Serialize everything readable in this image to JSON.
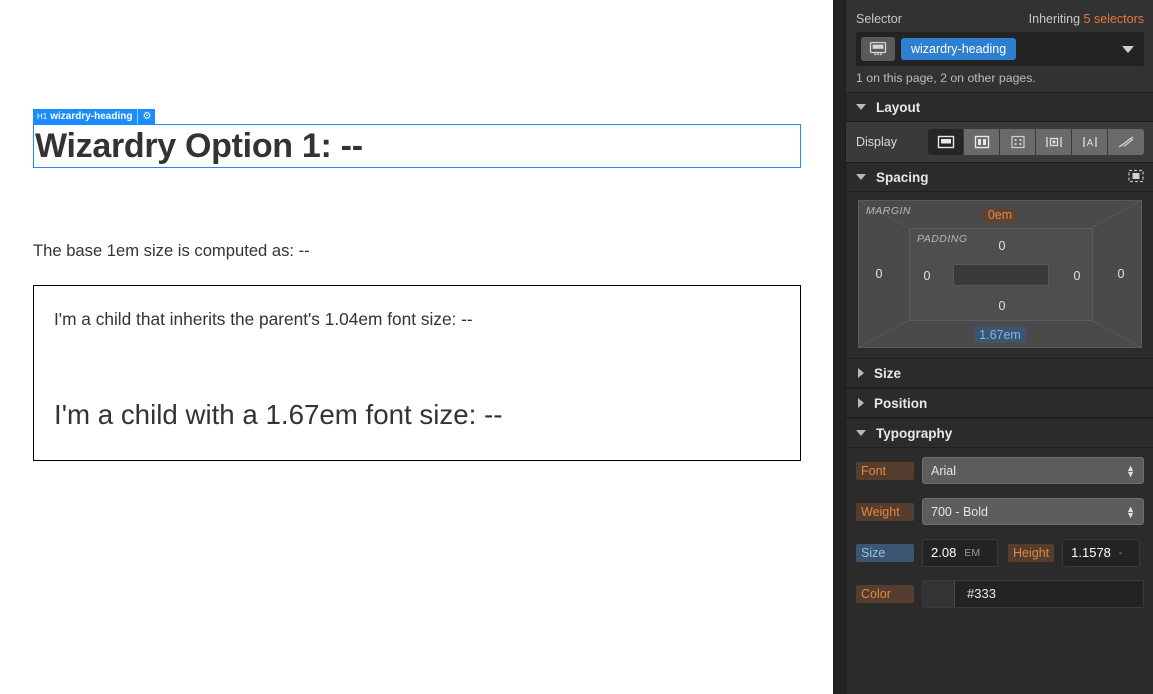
{
  "canvas": {
    "badge": {
      "tag": "H1",
      "name": "wizardry-heading",
      "gear_icon": "gear-icon"
    },
    "heading": "Wizardry Option 1: --",
    "paragraph": "The base 1em size is computed as: --",
    "child_inherit": "I'm a child that inherits the parent's 1.04em font size: --",
    "child_sized": "I'm a child with a 1.67em font size: --"
  },
  "panel": {
    "selector": {
      "label": "Selector",
      "inheriting_prefix": "Inheriting ",
      "inheriting_count": "5 selectors",
      "device_icon": "desktop-icon",
      "chip": "wizardry-heading",
      "dropdown_icon": "chevron-down-icon",
      "usage": "1 on this page, 2 on other pages."
    },
    "sections": {
      "layout": {
        "title": "Layout",
        "expanded": true
      },
      "spacing": {
        "title": "Spacing",
        "expanded": true,
        "icon": "box-model-icon"
      },
      "size": {
        "title": "Size",
        "expanded": false
      },
      "position": {
        "title": "Position",
        "expanded": false
      },
      "typography": {
        "title": "Typography",
        "expanded": true
      }
    },
    "display": {
      "label": "Display",
      "options": [
        {
          "icon": "display-block-icon",
          "active": true
        },
        {
          "icon": "display-flex-icon",
          "active": false
        },
        {
          "icon": "display-grid-icon",
          "active": false
        },
        {
          "icon": "display-inline-block-icon",
          "active": false
        },
        {
          "icon": "display-inline-icon",
          "active": false
        },
        {
          "icon": "display-none-icon",
          "active": false
        }
      ]
    },
    "box_model": {
      "margin_label": "MARGIN",
      "padding_label": "PADDING",
      "margin": {
        "top": "0em",
        "right": "0",
        "bottom": "1.67em",
        "left": "0"
      },
      "padding": {
        "top": "0",
        "right": "0",
        "bottom": "0",
        "left": "0"
      },
      "highlight_top_color": "#e4863c",
      "highlight_bottom_color": "#7cb7e8"
    },
    "typography": {
      "font": {
        "label": "Font",
        "value": "Arial"
      },
      "weight": {
        "label": "Weight",
        "value": "700 - Bold"
      },
      "size": {
        "label": "Size",
        "value": "2.08",
        "unit": "EM"
      },
      "height": {
        "label": "Height",
        "value": "1.1578",
        "unit": "-"
      },
      "color": {
        "label": "Color",
        "value": "#333",
        "swatch": "#333333"
      }
    }
  }
}
